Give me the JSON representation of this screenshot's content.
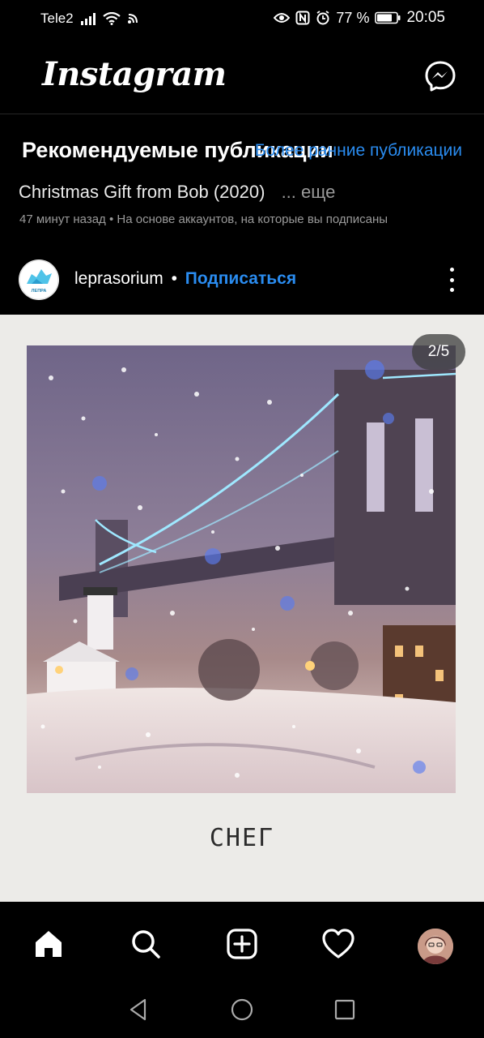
{
  "status_bar": {
    "carrier": "Tele2",
    "battery_percent": "77 %",
    "time": "20:05"
  },
  "app_bar": {
    "logo": "Instagram",
    "messenger_icon": "messenger-icon"
  },
  "feed": {
    "section_title": "Рекомендуемые публикации",
    "older_posts_link": "Более ранние публикации",
    "caption_text": "Christmas Gift from Bob (2020)",
    "caption_more": "... еще",
    "meta": "47 минут назад • На основе аккаунтов, на которые вы подписаны"
  },
  "post": {
    "username": "leprasorium",
    "separator": "•",
    "follow_label": "Подписаться",
    "avatar_text": "ЛЕПРА",
    "counter": "2/5",
    "image_caption": "СНЕГ"
  },
  "bottom_nav": {
    "items": [
      "home-icon",
      "search-icon",
      "new-post-icon",
      "activity-icon",
      "profile-avatar"
    ]
  },
  "system_nav": {
    "items": [
      "back-icon",
      "home-circle-icon",
      "recents-icon"
    ]
  },
  "colors": {
    "background": "#000000",
    "accent_blue": "#2a8cf0",
    "muted_text": "#9a9a9a"
  }
}
